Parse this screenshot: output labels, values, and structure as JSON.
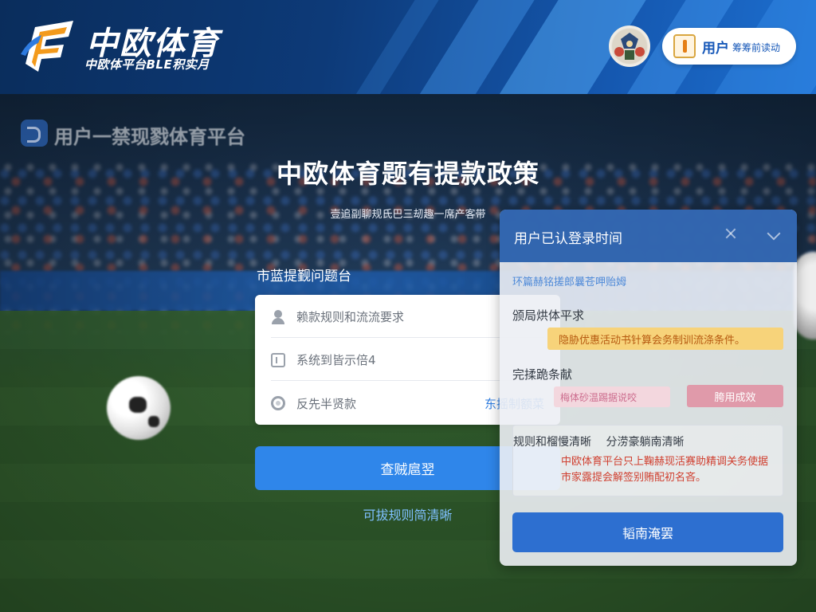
{
  "header": {
    "brand_title": "中欧体育",
    "brand_subtitle": "中欧体平台BLE积实月",
    "user_name": "用户",
    "user_sub": "筹筹前读动",
    "colors": {
      "primary": "#2f86ea",
      "header_dark": "#0a2d5c"
    }
  },
  "background": {
    "ghost_title": "用户一禁现戮体育平台"
  },
  "main": {
    "title": "中欧体育题有提款政策",
    "subtitle": "壹追副聊规氏巴三刼趣一席产客带",
    "form_label": "市蓝提觐问题台",
    "fields": [
      {
        "icon": "user-icon",
        "placeholder": "赖款规则和流流要求"
      },
      {
        "icon": "doc-icon",
        "placeholder": "系统到皆示倍4"
      },
      {
        "icon": "circle-icon",
        "placeholder": "反先半贤款",
        "link": "东摇制额菜"
      }
    ],
    "primary_button": "查贼扈翌",
    "bottom_link": "可拔规则简清晰"
  },
  "panel": {
    "title": "用户已认登录时间",
    "note": "环篇赫铭搓郎曩苍呷贻姆",
    "heading1": "颁局烘体平求",
    "warning": "隐胁优惠活动书针算会务制训流涤条件。",
    "heading2": "完揉跪条献",
    "tag_text": "梅体砂温踢据说咬",
    "tag_button": "胯用成效",
    "box_heading_a": "规则和榴慢清晰",
    "box_heading_b": "分涝豪躺南清晰",
    "box_text": "中欧体育平台只上鞠赫现活赛助精调关务使据市家露提会解签别贿配初名吝。",
    "button": "韬南淹罢"
  }
}
